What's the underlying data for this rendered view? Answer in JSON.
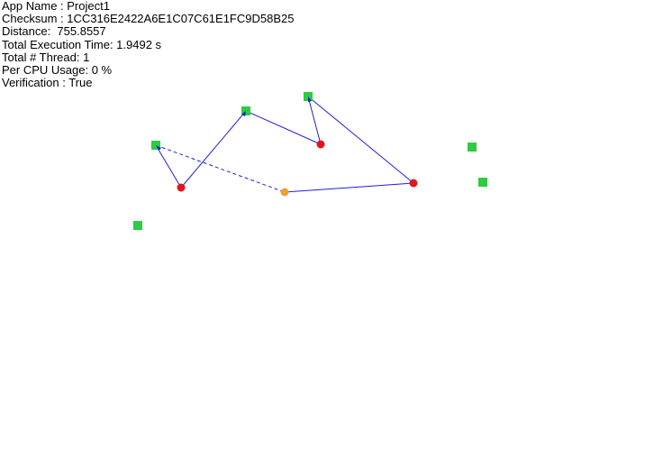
{
  "info": {
    "app_name": "App Name : Project1",
    "checksum": "Checksum : 1CC316E2422A6E1C07C61E1FC9D58B25",
    "distance": "Distance:  755.8557",
    "execution_time": "Total Execution Time: 1.9492 s",
    "threads": "Total # Thread: 1",
    "cpu_usage": "Per CPU Usage: 0 %",
    "verification": "Verification : True"
  },
  "colors": {
    "route": "#1f1fd6",
    "green_node": "#2ecc40",
    "red_node": "#e0161f",
    "orange_node": "#f0a030"
  }
}
